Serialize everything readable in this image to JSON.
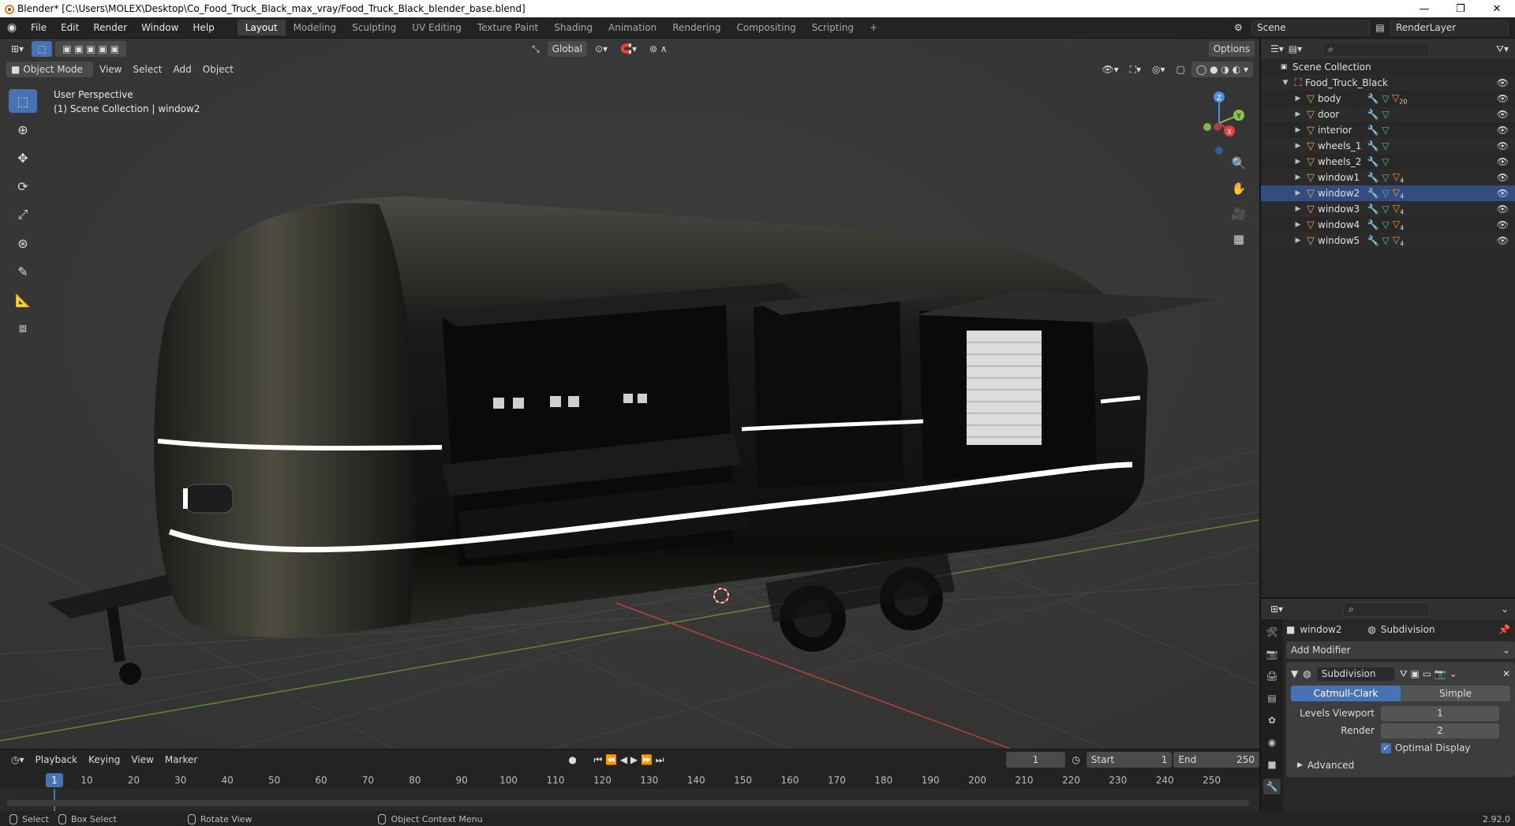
{
  "window": {
    "title": "Blender* [C:\\Users\\MOLEX\\Desktop\\Co_Food_Truck_Black_max_vray/Food_Truck_Black_blender_base.blend]",
    "minimize": "—",
    "maximize": "❐",
    "close": "✕"
  },
  "menubar": {
    "items": [
      "File",
      "Edit",
      "Render",
      "Window",
      "Help"
    ],
    "workspaces": [
      "Layout",
      "Modeling",
      "Sculpting",
      "UV Editing",
      "Texture Paint",
      "Shading",
      "Animation",
      "Rendering",
      "Compositing",
      "Scripting"
    ],
    "active_workspace": "Layout",
    "add_tab": "+",
    "scene": "Scene",
    "render_layer": "RenderLayer"
  },
  "viewport": {
    "transform_orientation": "Global",
    "options_label": "Options",
    "mode": "Object Mode",
    "menu": [
      "View",
      "Select",
      "Add",
      "Object"
    ],
    "perspective_label": "User Perspective",
    "collection_label": "(1) Scene Collection | window2",
    "gizmo_axes": {
      "x": "X",
      "y": "Y",
      "z": "Z"
    }
  },
  "timeline": {
    "menu": [
      "Playback",
      "Keying",
      "View",
      "Marker"
    ],
    "current_frame": "1",
    "start_label": "Start",
    "start": "1",
    "end_label": "End",
    "end": "250",
    "ruler": [
      "10",
      "20",
      "30",
      "40",
      "50",
      "60",
      "70",
      "80",
      "90",
      "100",
      "110",
      "120",
      "130",
      "140",
      "150",
      "160",
      "170",
      "180",
      "190",
      "200",
      "210",
      "220",
      "230",
      "240",
      "250"
    ],
    "cursor_label": "1"
  },
  "status": {
    "select": "Select",
    "box_select": "Box Select",
    "rotate_view": "Rotate View",
    "context_menu": "Object Context Menu",
    "version": "2.92.0"
  },
  "outliner": {
    "root": "Scene Collection",
    "collection": "Food_Truck_Black",
    "objects": [
      {
        "name": "body",
        "badge": "20"
      },
      {
        "name": "door",
        "badge": ""
      },
      {
        "name": "interior",
        "badge": ""
      },
      {
        "name": "wheels_1",
        "badge": ""
      },
      {
        "name": "wheels_2",
        "badge": ""
      },
      {
        "name": "window1",
        "badge": "4"
      },
      {
        "name": "window2",
        "badge": "4"
      },
      {
        "name": "window3",
        "badge": "4"
      },
      {
        "name": "window4",
        "badge": "4"
      },
      {
        "name": "window5",
        "badge": "4"
      }
    ],
    "selected": "window2"
  },
  "properties": {
    "object_name": "window2",
    "modifier_crumb": "Subdivision",
    "add_modifier": "Add Modifier",
    "modifier_name": "Subdivision",
    "mode_catmull": "Catmull-Clark",
    "mode_simple": "Simple",
    "levels_viewport_label": "Levels Viewport",
    "levels_viewport": "1",
    "render_label": "Render",
    "render": "2",
    "optimal_display": "Optimal Display",
    "advanced": "Advanced"
  },
  "colors": {
    "accent": "#4772b3",
    "viewport_bg": "#393939",
    "object_orange": "#ed9f52",
    "mesh_green": "#3bc7a3"
  }
}
